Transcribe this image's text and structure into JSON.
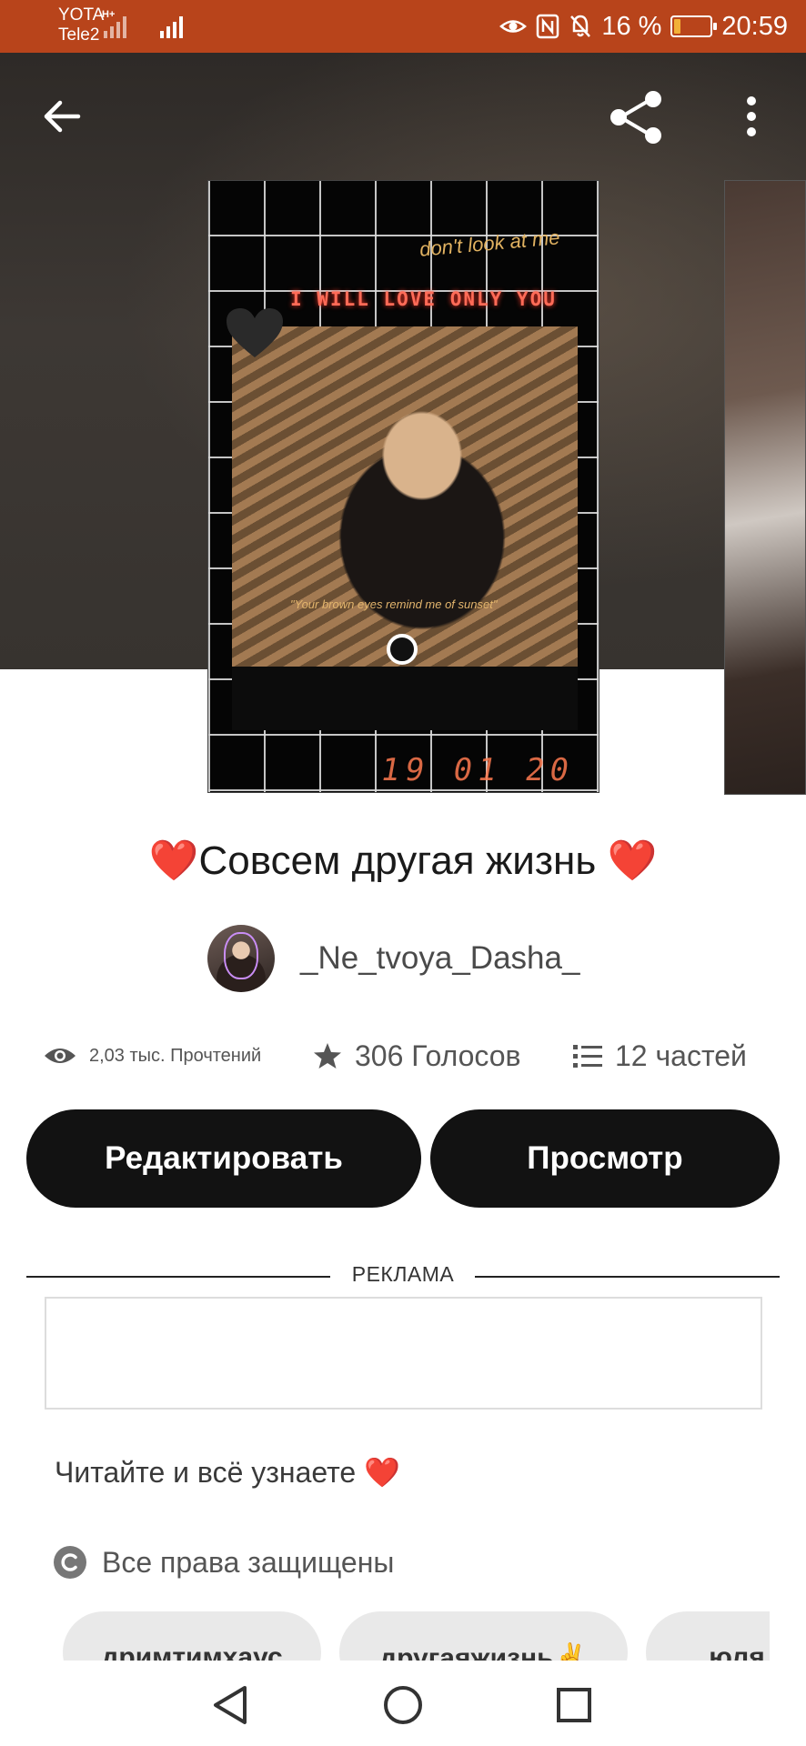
{
  "status_bar": {
    "carrier_1": "YOTA",
    "carrier_2": "Tele2",
    "network_type": "H+",
    "battery_text": "16 %",
    "battery_level": 0.16,
    "time": "20:59",
    "colors": {
      "background": "#b8441b",
      "battery_fill": "#f2b138"
    }
  },
  "toolbar": {
    "back_icon": "arrow-left-icon",
    "share_icon": "share-icon",
    "more_icon": "more-vertical-icon"
  },
  "cover": {
    "text_1": "don't look at me",
    "text_2": "I WILL LOVE ONLY YOU",
    "text_3": "\"Your brown eyes remind me of sunset\"",
    "text_4": "19 01 20"
  },
  "story": {
    "title": "❤️Совсем другая жизнь ❤️",
    "author": "_Ne_tvoya_Dasha_",
    "stats": {
      "reads": "2,03 тыс. Прочтений",
      "votes": "306 Голосов",
      "parts": "12 частей"
    },
    "description": "Читайте и всё узнаете ❤️",
    "rights": "Все права защищены"
  },
  "actions": {
    "edit_label": "Редактировать",
    "view_label": "Просмотр"
  },
  "ad": {
    "label": "РЕКЛАМА"
  },
  "tags": [
    {
      "label": "дримтимхаус"
    },
    {
      "label": "другаяжизнь✌️"
    },
    {
      "label": "юля"
    }
  ],
  "nav": {
    "back_icon": "triangle-back-icon",
    "home_icon": "circle-home-icon",
    "recents_icon": "square-recents-icon"
  }
}
